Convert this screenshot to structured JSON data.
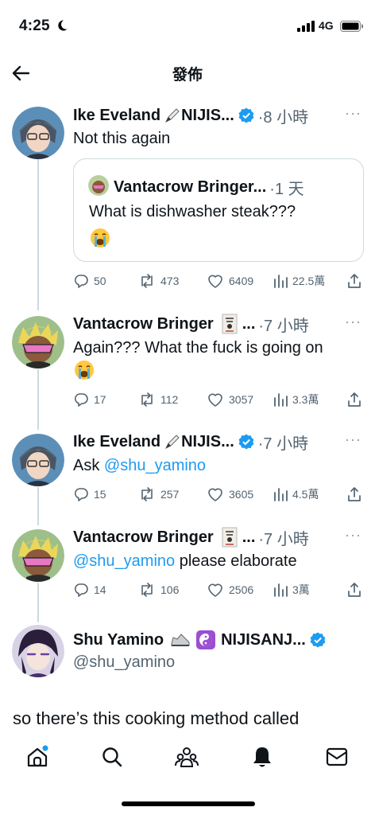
{
  "status_bar": {
    "time": "4:25",
    "network": "4G"
  },
  "header": {
    "title": "發佈"
  },
  "tweets": [
    {
      "name": "Ike Eveland",
      "name_suffix": "NIJIS...",
      "meta": "·8 小時",
      "text": "Not this again",
      "quote": {
        "name": "Vantacrow Bringer...",
        "meta": "·1 天",
        "text": "What is dishwasher steak???"
      },
      "stats": {
        "replies": "50",
        "retweets": "473",
        "likes": "6409",
        "views": "22.5萬"
      }
    },
    {
      "name": "Vantacrow Bringer",
      "name_suffix": "...",
      "meta": "·7 小時",
      "text": "Again??? What the fuck is going on",
      "stats": {
        "replies": "17",
        "retweets": "112",
        "likes": "3057",
        "views": "3.3萬"
      }
    },
    {
      "name": "Ike Eveland",
      "name_suffix": "NIJIS...",
      "meta": "·7 小時",
      "text_prefix": "Ask ",
      "mention": "@shu_yamino",
      "stats": {
        "replies": "15",
        "retweets": "257",
        "likes": "3605",
        "views": "4.5萬"
      }
    },
    {
      "name": "Vantacrow Bringer",
      "name_suffix": "...",
      "meta": "·7 小時",
      "mention": "@shu_yamino",
      "text_suffix": " please elaborate",
      "stats": {
        "replies": "14",
        "retweets": "106",
        "likes": "2506",
        "views": "3萬"
      }
    }
  ],
  "main_post": {
    "name": "Shu Yamino",
    "name_suffix": "NIJISANJ...",
    "handle": "@shu_yamino",
    "text": "so there’s this cooking method called"
  },
  "icons": {
    "verified": "verified-badge-icon",
    "more": "more-dots-icon",
    "reply": "reply-icon",
    "retweet": "retweet-icon",
    "like": "heart-icon",
    "views": "views-icon",
    "share": "share-icon"
  },
  "colors": {
    "accent": "#1d9bf0",
    "muted": "#536471",
    "border": "#cfd9de"
  }
}
